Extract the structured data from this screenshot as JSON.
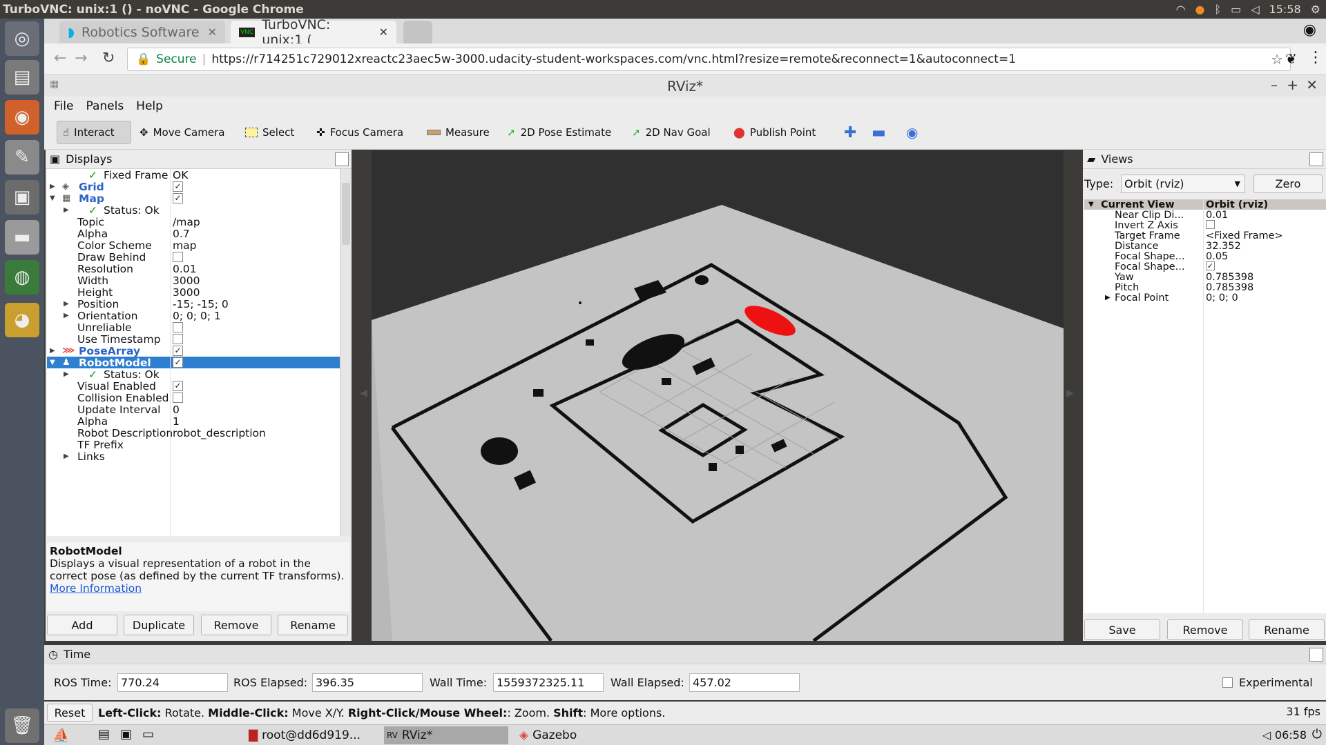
{
  "os": {
    "window_title": "TurboVNC: unix:1 () - noVNC - Google Chrome",
    "clock": "15:58"
  },
  "browser": {
    "tabs": [
      {
        "label": "Robotics Software"
      },
      {
        "label": "TurboVNC: unix:1 ("
      }
    ],
    "secure_label": "Secure",
    "url": "https://r714251c729012xreactc23aec5w-3000.udacity-student-workspaces.com/vnc.html?resize=remote&reconnect=1&autoconnect=1"
  },
  "rviz": {
    "title": "RViz*",
    "menu": [
      "File",
      "Panels",
      "Help"
    ],
    "tools": [
      "Interact",
      "Move Camera",
      "Select",
      "Focus Camera",
      "Measure",
      "2D Pose Estimate",
      "2D Nav Goal",
      "Publish Point"
    ]
  },
  "displays": {
    "title": "Displays",
    "rows": [
      {
        "label": "Fixed Frame",
        "value": "OK"
      },
      {
        "label": "Grid",
        "value": "✓"
      },
      {
        "label": "Map",
        "value": "✓"
      },
      {
        "label": "Status: Ok",
        "value": ""
      },
      {
        "label": "Topic",
        "value": "/map"
      },
      {
        "label": "Alpha",
        "value": "0.7"
      },
      {
        "label": "Color Scheme",
        "value": "map"
      },
      {
        "label": "Draw Behind",
        "value": ""
      },
      {
        "label": "Resolution",
        "value": "0.01"
      },
      {
        "label": "Width",
        "value": "3000"
      },
      {
        "label": "Height",
        "value": "3000"
      },
      {
        "label": "Position",
        "value": "-15; -15; 0"
      },
      {
        "label": "Orientation",
        "value": "0; 0; 0; 1"
      },
      {
        "label": "Unreliable",
        "value": ""
      },
      {
        "label": "Use Timestamp",
        "value": ""
      },
      {
        "label": "PoseArray",
        "value": "✓"
      },
      {
        "label": "RobotModel",
        "value": "✓"
      },
      {
        "label": "Status: Ok",
        "value": ""
      },
      {
        "label": "Visual Enabled",
        "value": "✓"
      },
      {
        "label": "Collision Enabled",
        "value": ""
      },
      {
        "label": "Update Interval",
        "value": "0"
      },
      {
        "label": "Alpha",
        "value": "1"
      },
      {
        "label": "Robot Description",
        "value": "robot_description"
      },
      {
        "label": "TF Prefix",
        "value": ""
      },
      {
        "label": "Links",
        "value": ""
      }
    ],
    "desc_title": "RobotModel",
    "desc_text": "Displays a visual representation of a robot in the correct pose (as defined by the current TF transforms).",
    "more_info": "More Information",
    "buttons": [
      "Add",
      "Duplicate",
      "Remove",
      "Rename"
    ]
  },
  "views": {
    "title": "Views",
    "type_label": "Type:",
    "type_value": "Orbit (rviz)",
    "zero": "Zero",
    "rows": [
      {
        "label": "Current View",
        "value": "Orbit (rviz)"
      },
      {
        "label": "Near Clip Di...",
        "value": "0.01"
      },
      {
        "label": "Invert Z Axis",
        "value": ""
      },
      {
        "label": "Target Frame",
        "value": "<Fixed Frame>"
      },
      {
        "label": "Distance",
        "value": "32.352"
      },
      {
        "label": "Focal Shape...",
        "value": "0.05"
      },
      {
        "label": "Focal Shape...",
        "value": "✓"
      },
      {
        "label": "Yaw",
        "value": "0.785398"
      },
      {
        "label": "Pitch",
        "value": "0.785398"
      },
      {
        "label": "Focal Point",
        "value": "0; 0; 0"
      }
    ],
    "buttons": [
      "Save",
      "Remove",
      "Rename"
    ]
  },
  "time": {
    "title": "Time",
    "ros_time_label": "ROS Time:",
    "ros_time": "770.24",
    "ros_elapsed_label": "ROS Elapsed:",
    "ros_elapsed": "396.35",
    "wall_time_label": "Wall Time:",
    "wall_time": "1559372325.11",
    "wall_elapsed_label": "Wall Elapsed:",
    "wall_elapsed": "457.02",
    "experimental": "Experimental"
  },
  "status": {
    "reset": "Reset",
    "help_b1": "Left-Click:",
    "help_t1": " Rotate. ",
    "help_b2": "Middle-Click:",
    "help_t2": " Move X/Y. ",
    "help_b3": "Right-Click/Mouse Wheel:",
    "help_t3": ": Zoom. ",
    "help_b4": "Shift",
    "help_t4": ": More options.",
    "fps": "31 fps"
  },
  "taskbar": {
    "items": [
      "root@dd6d919...",
      "RViz*",
      "Gazebo"
    ],
    "clock": "06:58"
  }
}
